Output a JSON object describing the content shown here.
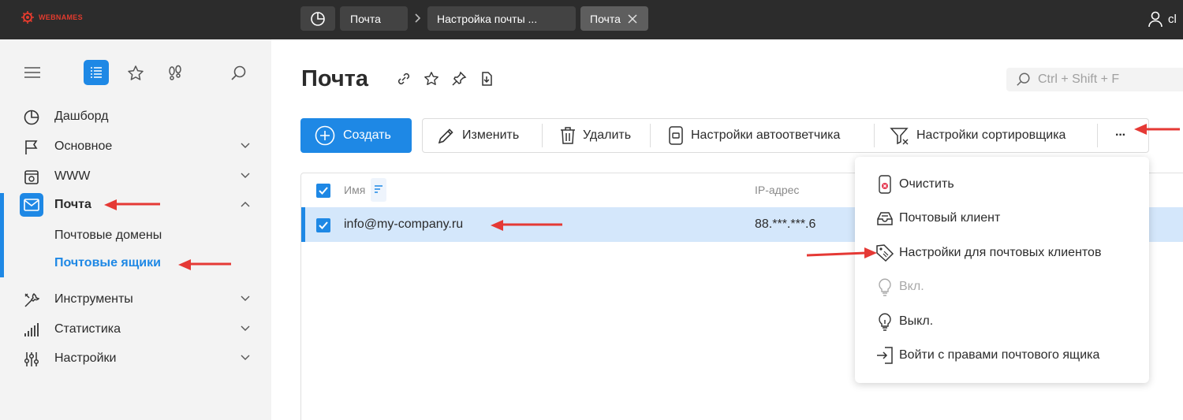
{
  "topbar": {
    "logo_text": "WEBNAMES",
    "tabs": [
      {
        "label": "Почта"
      },
      {
        "label": "Настройка почты ..."
      },
      {
        "label": "Почта"
      }
    ],
    "user_label": "cl"
  },
  "sidebar": {
    "nav": [
      {
        "label": "Дашборд"
      },
      {
        "label": "Основное"
      },
      {
        "label": "WWW"
      },
      {
        "label": "Почта"
      },
      {
        "label": "Инструменты"
      },
      {
        "label": "Статистика"
      },
      {
        "label": "Настройки"
      }
    ],
    "mail_sub": [
      {
        "label": "Почтовые домены"
      },
      {
        "label": "Почтовые ящики"
      }
    ]
  },
  "page": {
    "title": "Почта",
    "search_placeholder": "Ctrl + Shift + F"
  },
  "toolbar": {
    "create": "Создать",
    "edit": "Изменить",
    "delete": "Удалить",
    "autoresponder": "Настройки автоответчика",
    "sorter": "Настройки сортировщика",
    "more": "···"
  },
  "table": {
    "columns": [
      {
        "label": "Имя"
      },
      {
        "label": "IP-адрес"
      }
    ],
    "rows": [
      {
        "name": "info@my-company.ru",
        "ip": "88.***.***.6"
      }
    ]
  },
  "dropdown": {
    "items": [
      {
        "label": "Очистить"
      },
      {
        "label": "Почтовый клиент"
      },
      {
        "label": "Настройки для почтовых клиентов"
      },
      {
        "label": "Вкл."
      },
      {
        "label": "Выкл."
      },
      {
        "label": "Войти с правами почтового ящика"
      }
    ]
  },
  "colors": {
    "accent": "#1e88e5",
    "annotation": "#e53935",
    "topbar": "#2c2c2c"
  }
}
